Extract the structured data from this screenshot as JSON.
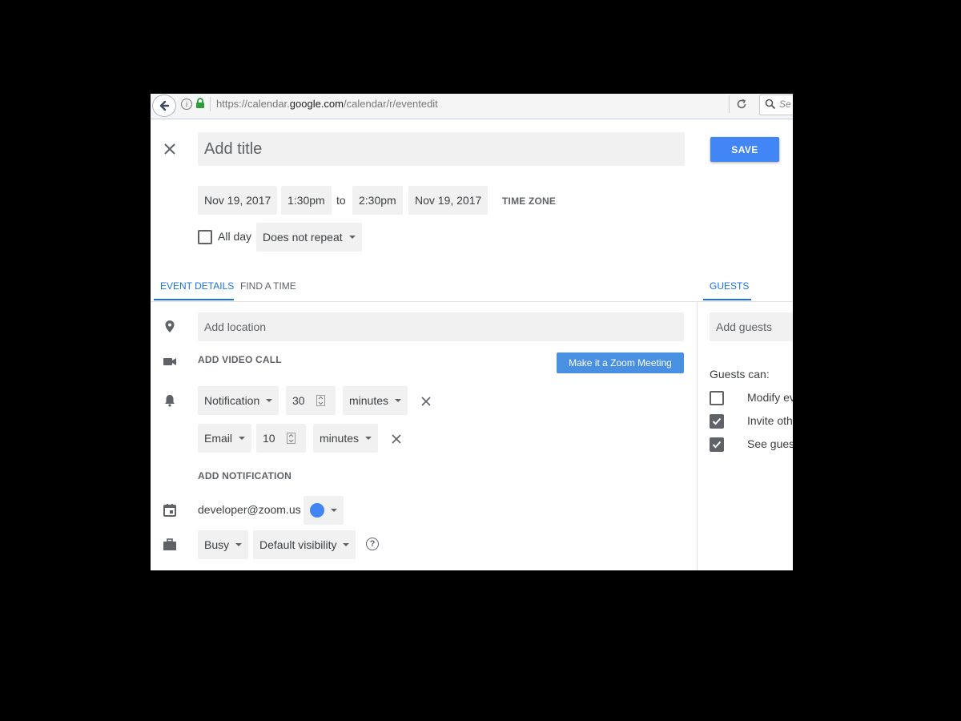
{
  "browser": {
    "url_prefix": "https://calendar.",
    "url_domain": "google.com",
    "url_path": "/calendar/r/eventedit",
    "search_placeholder": "Se"
  },
  "header": {
    "title_placeholder": "Add title",
    "save_label": "SAVE"
  },
  "datetime": {
    "start_date": "Nov 19, 2017",
    "start_time": "1:30pm",
    "to_label": "to",
    "end_time": "2:30pm",
    "end_date": "Nov 19, 2017",
    "timezone_label": "TIME ZONE",
    "all_day_label": "All day",
    "repeat_value": "Does not repeat"
  },
  "tabs": {
    "event_details": "EVENT DETAILS",
    "find_a_time": "FIND A TIME",
    "guests": "GUESTS"
  },
  "details": {
    "location_placeholder": "Add location",
    "video_call_label": "ADD VIDEO CALL",
    "zoom_button": "Make it a Zoom Meeting",
    "notifications": [
      {
        "type": "Notification",
        "amount": "30",
        "unit": "minutes"
      },
      {
        "type": "Email",
        "amount": "10",
        "unit": "minutes"
      }
    ],
    "add_notification_label": "ADD NOTIFICATION",
    "calendar_owner": "developer@zoom.us",
    "calendar_color": "#4285f4",
    "availability": "Busy",
    "visibility": "Default visibility"
  },
  "guests": {
    "add_placeholder": "Add guests",
    "guests_can_label": "Guests can:",
    "permissions": [
      {
        "label": "Modify ev",
        "checked": false
      },
      {
        "label": "Invite oth",
        "checked": true
      },
      {
        "label": "See gues",
        "checked": true
      }
    ]
  },
  "colors": {
    "accent": "#1a73e8",
    "save_button": "#4285f4",
    "zoom_button": "#4a90e2"
  }
}
